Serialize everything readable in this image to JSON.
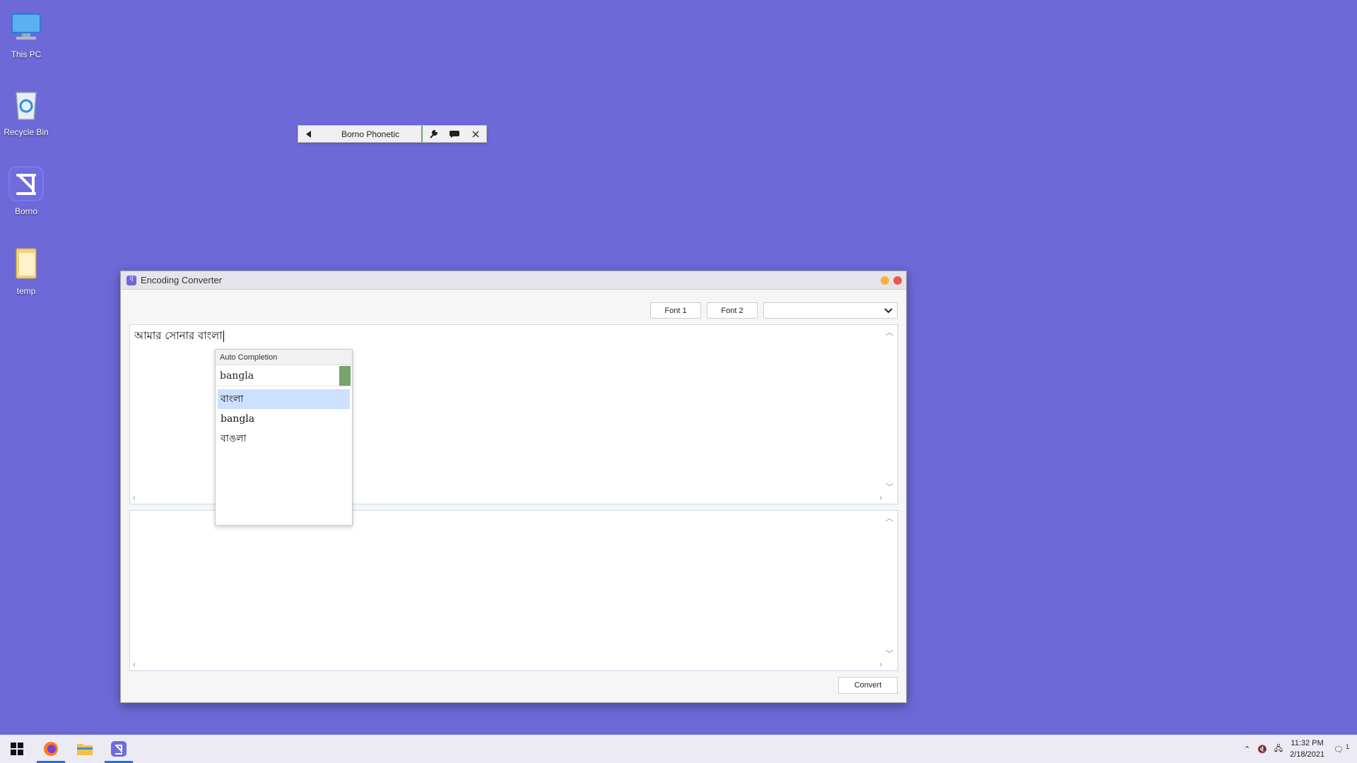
{
  "desktop": {
    "icons": [
      {
        "label": "This PC"
      },
      {
        "label": "Recycle Bin"
      },
      {
        "label": "Borno"
      },
      {
        "label": "temp"
      }
    ]
  },
  "borno_toolbar": {
    "mode_label": "Borno Phonetic",
    "accent": "#6aa86a"
  },
  "window": {
    "title": "Encoding Converter",
    "buttons": {
      "font1": "Font 1",
      "font2": "Font 2",
      "convert": "Convert"
    },
    "dropdown_value": "",
    "input_text": "আমার সোনার বাংলা",
    "output_text": ""
  },
  "autocomplete": {
    "header": "Auto Completion",
    "query": "bangla",
    "suggestions": [
      "বাংলা",
      "bangla",
      "বাঙলা"
    ],
    "selected_index": 0
  },
  "taskbar": {
    "time": "11:32 PM",
    "date": "2/18/2021",
    "notification_count": "1"
  },
  "colors": {
    "desktop_bg": "#6d69d9",
    "selection": "#cde0ff",
    "minimize": "#f5b33a",
    "close": "#ee5a4a"
  }
}
